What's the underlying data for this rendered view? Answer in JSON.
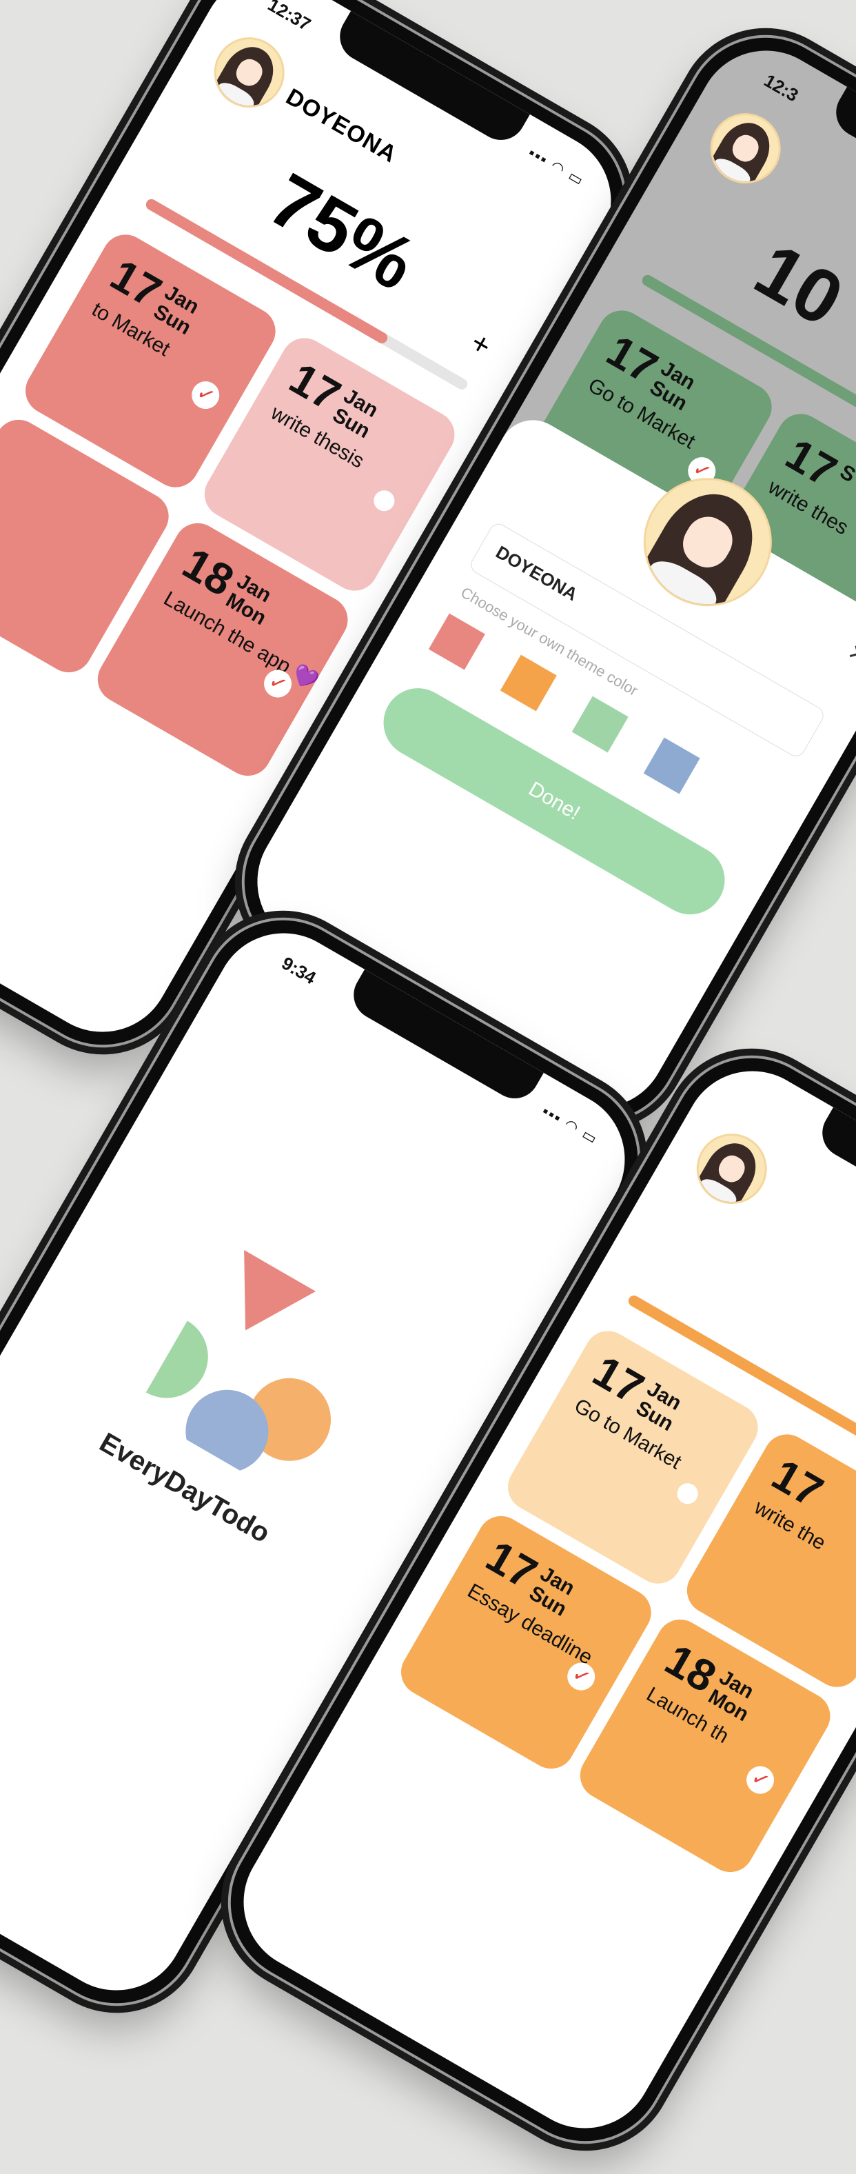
{
  "phone1": {
    "time": "12:37",
    "user_name": "DOYEONA",
    "progress_label": "75%",
    "progress": 0.75,
    "add_button": "+",
    "theme_color": "#e8877f",
    "cards": [
      {
        "day": "17",
        "month": "Jan",
        "weekday": "Sun",
        "task": "to Market",
        "done": true,
        "color": "#e8877f"
      },
      {
        "day": "17",
        "month": "Jan",
        "weekday": "Sun",
        "task": "write thesis",
        "done": false,
        "color": "#f3c2c0"
      },
      {
        "day": "18",
        "month": "Jan",
        "weekday": "Mon",
        "task": "Launch the app",
        "emoji": "💜",
        "done": true,
        "color": "#e8877f"
      }
    ]
  },
  "phone2": {
    "time": "12:3",
    "progress_label": "10",
    "theme_color": "#6f9f77",
    "cards": [
      {
        "day": "17",
        "month": "Jan",
        "weekday": "Sun",
        "task": "Go to Market",
        "done": true
      },
      {
        "day": "17",
        "month": "S",
        "weekday": "",
        "task": "write thes",
        "done": false
      }
    ],
    "sheet": {
      "name_value": "DOYEONA",
      "hint": "Choose your own theme color",
      "close_icon": "×",
      "swatches": [
        "#e8877f",
        "#f5a34b",
        "#9fd5a6",
        "#8faad1"
      ],
      "done_label": "Done!",
      "done_color": "#a1dbab"
    }
  },
  "phone3": {
    "time": "9:34",
    "app_name": "EveryDayTodo",
    "logo_colors": [
      "#e8877f",
      "#f5b06c",
      "#a1d6a5",
      "#98b0d6"
    ]
  },
  "phone4": {
    "theme_color": "#f5a34b",
    "cards": [
      {
        "day": "17",
        "month": "Jan",
        "weekday": "Sun",
        "task": "Go to Market",
        "done": false,
        "color": "#fcdcae"
      },
      {
        "day": "17",
        "month": "Jan",
        "weekday": "Sun",
        "task": "Essay deadline",
        "done": true,
        "color": "#f7ab55"
      },
      {
        "day": "17",
        "month": "",
        "weekday": "",
        "task": "write the",
        "done": false,
        "color": "#f7ab55"
      },
      {
        "day": "18",
        "month": "Jan",
        "weekday": "Mon",
        "task": "Launch th",
        "done": true,
        "color": "#f7ab55"
      }
    ]
  }
}
